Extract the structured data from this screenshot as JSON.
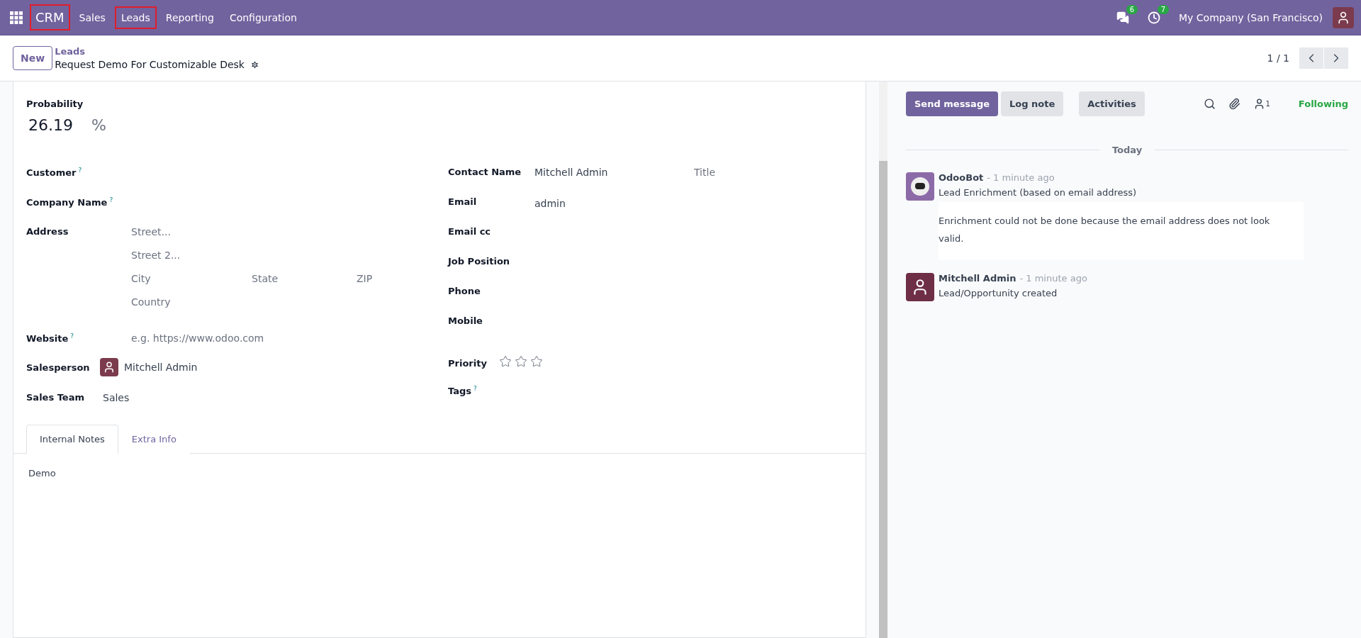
{
  "navbar": {
    "brand": {
      "label": "CRM",
      "highlighted": true
    },
    "menu": [
      {
        "label": "Sales",
        "highlighted": false
      },
      {
        "label": "Leads",
        "highlighted": true
      },
      {
        "label": "Reporting",
        "highlighted": false
      },
      {
        "label": "Configuration",
        "highlighted": false
      }
    ],
    "messages_count": "6",
    "activities_count": "7",
    "company": "My Company (San Francisco)"
  },
  "control_panel": {
    "new_button": "New",
    "breadcrumb": "Leads",
    "record_title": "Request Demo For Customizable Desk",
    "pager": "1 / 1"
  },
  "form": {
    "probability": {
      "label": "Probability",
      "value": "26.19",
      "unit": "%"
    },
    "left_fields": [
      {
        "kind": "empty",
        "label": "Customer",
        "help_mark": "?"
      },
      {
        "kind": "empty",
        "label": "Company Name",
        "help_mark": "?"
      },
      {
        "kind": "address",
        "label": "Address",
        "street_placeholder": "Street...",
        "street2_placeholder": "Street 2...",
        "city_placeholder": "City",
        "state_placeholder": "State",
        "zip_placeholder": "ZIP",
        "country_placeholder": "Country"
      },
      {
        "kind": "placeholder",
        "label": "Website",
        "help_mark": "?",
        "placeholder": "e.g. https://www.odoo.com"
      },
      {
        "kind": "user",
        "label": "Salesperson",
        "value": "Mitchell Admin"
      },
      {
        "kind": "text",
        "label": "Sales Team",
        "value": "Sales"
      }
    ],
    "right_fields": [
      {
        "kind": "contact",
        "label": "Contact Name",
        "value": "Mitchell Admin",
        "title_placeholder": "Title"
      },
      {
        "kind": "text",
        "label": "Email",
        "value": "admin"
      },
      {
        "kind": "empty",
        "label": "Email cc"
      },
      {
        "kind": "empty",
        "label": "Job Position"
      },
      {
        "kind": "empty",
        "label": "Phone"
      },
      {
        "kind": "empty",
        "label": "Mobile"
      },
      {
        "kind": "priority",
        "label": "Priority",
        "stars": 0
      },
      {
        "kind": "empty",
        "label": "Tags",
        "help_mark": "?"
      }
    ],
    "tabs": [
      {
        "label": "Internal Notes",
        "selected": true
      },
      {
        "label": "Extra Info",
        "selected": false
      }
    ],
    "notes": "Demo"
  },
  "chatter": {
    "buttons": [
      {
        "label": "Send message",
        "kind": "primary"
      },
      {
        "label": "Log note",
        "kind": "secondary"
      },
      {
        "label": "Activities",
        "kind": "secondary"
      }
    ],
    "followers_count": "1",
    "follow_label": "Following",
    "date_separator": "Today",
    "messages": [
      {
        "author": "OdooBot",
        "kind": "bot",
        "time": "- 1 minute ago",
        "body": "Lead Enrichment (based on email address)",
        "note": "Enrichment could not be done because the email address does not look valid."
      },
      {
        "author": "Mitchell Admin",
        "kind": "user",
        "time": "- 1 minute ago",
        "body": "Lead/Opportunity created"
      }
    ]
  }
}
